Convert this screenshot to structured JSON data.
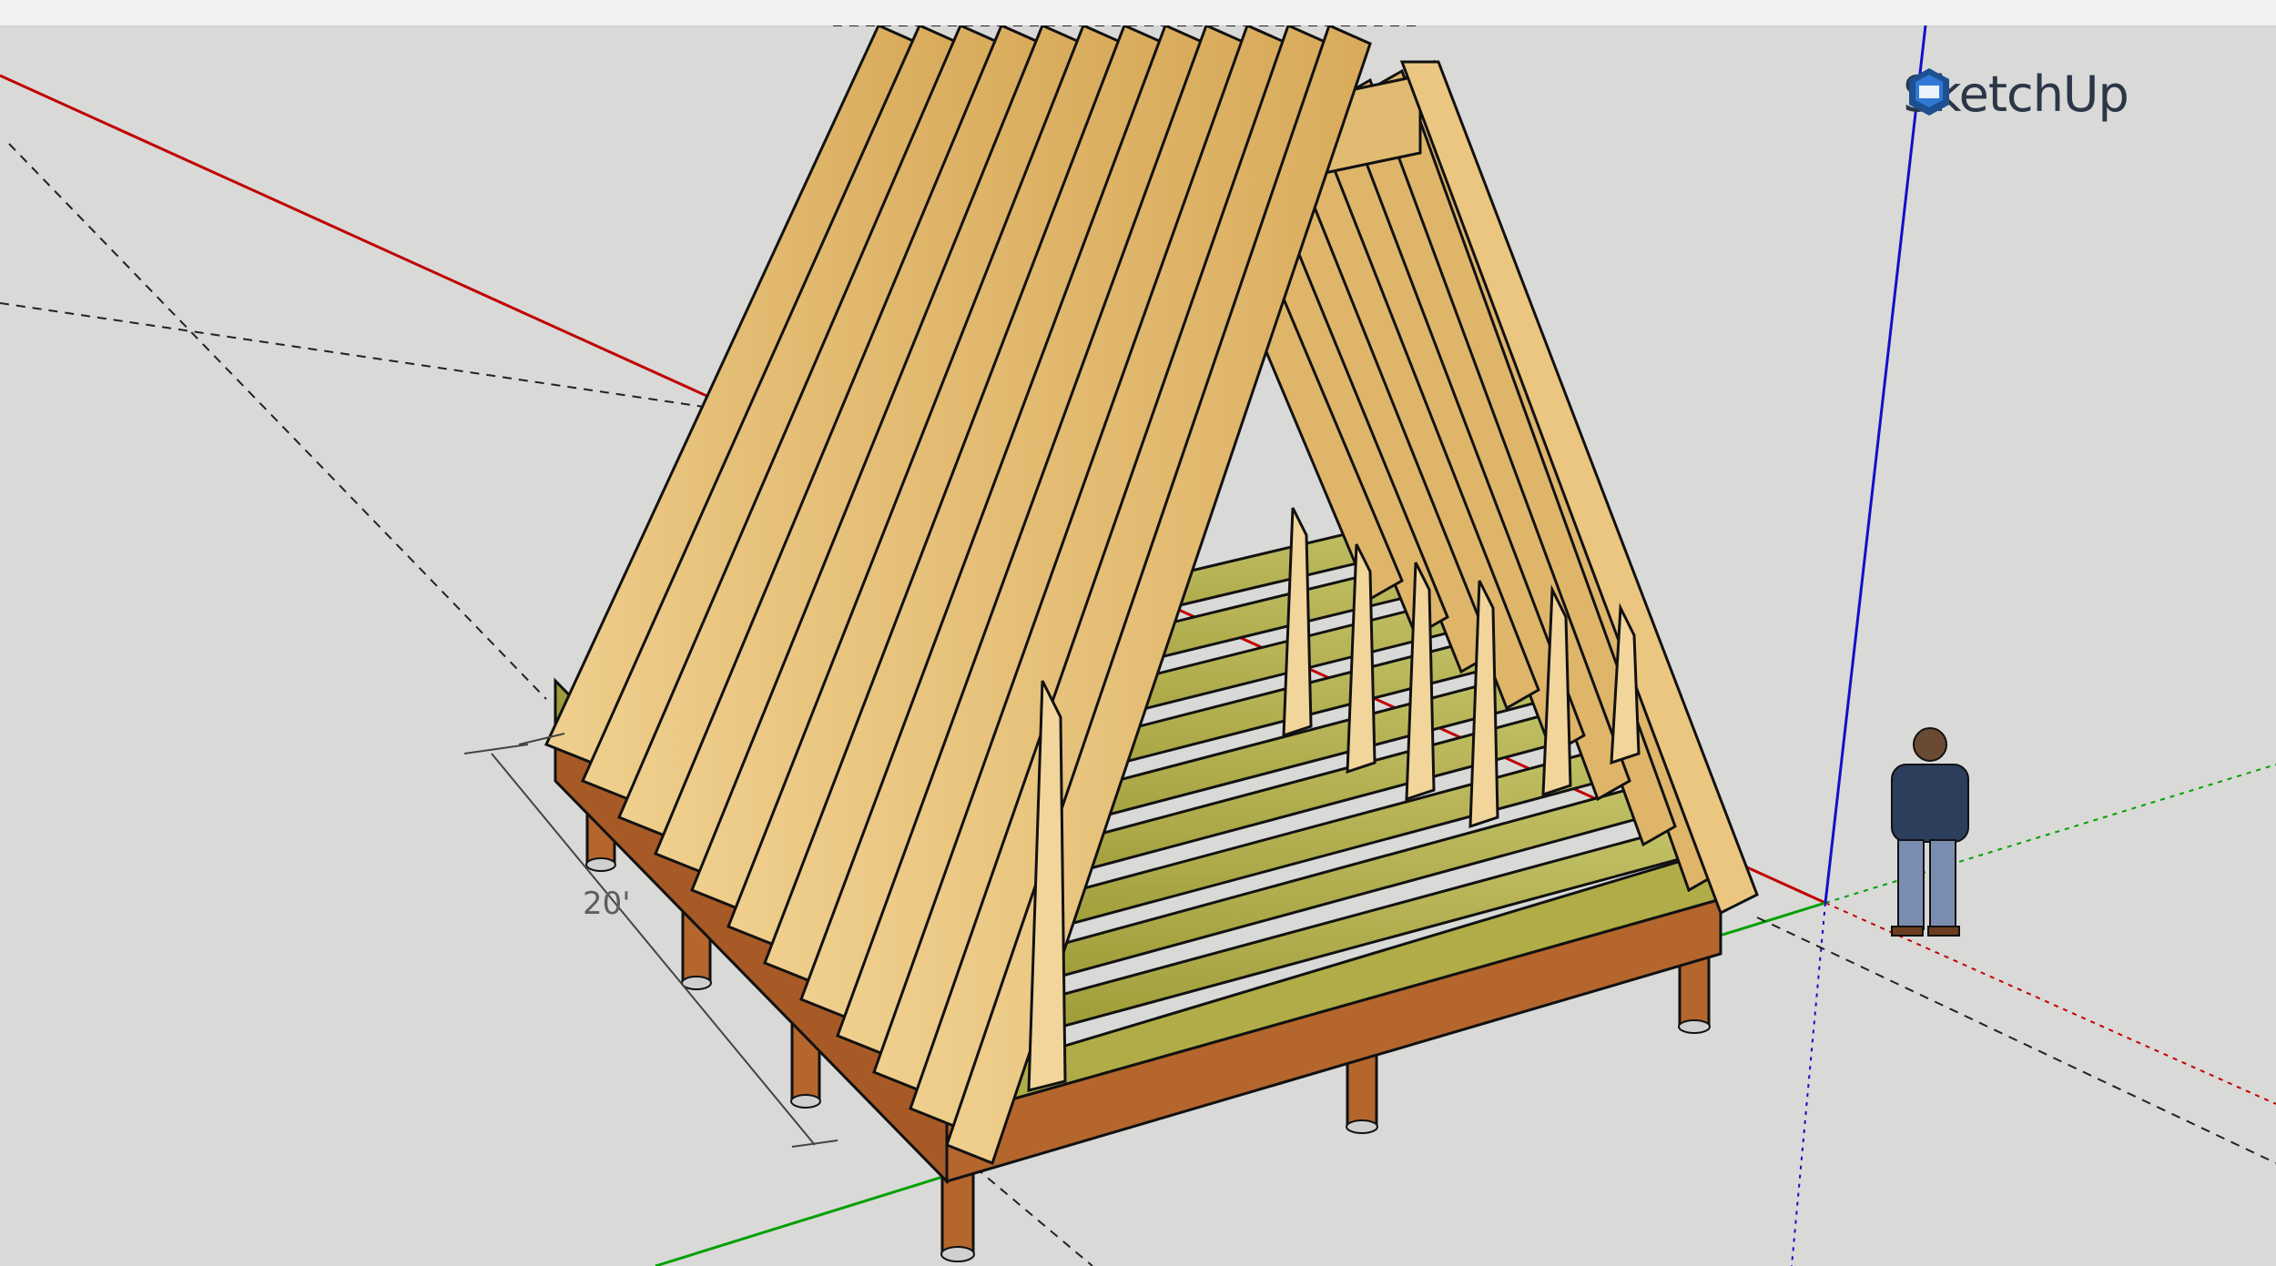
{
  "app": {
    "brand_name": "SketchUp",
    "brand_color": "#2b3748"
  },
  "viewport": {
    "background": "#d9d9d7",
    "dimension_label": "20'"
  },
  "axes": {
    "red": "#c00000",
    "green": "#00a000",
    "blue": "#1010c8"
  },
  "materials": {
    "rafter": "#e7c27a",
    "floor_joist": "#a9a641",
    "beam": "#b4662d",
    "post_cap": "#d0d0d0"
  },
  "icons": {
    "logo": "sketchup-logo-icon",
    "figure": "scale-figure-icon"
  }
}
